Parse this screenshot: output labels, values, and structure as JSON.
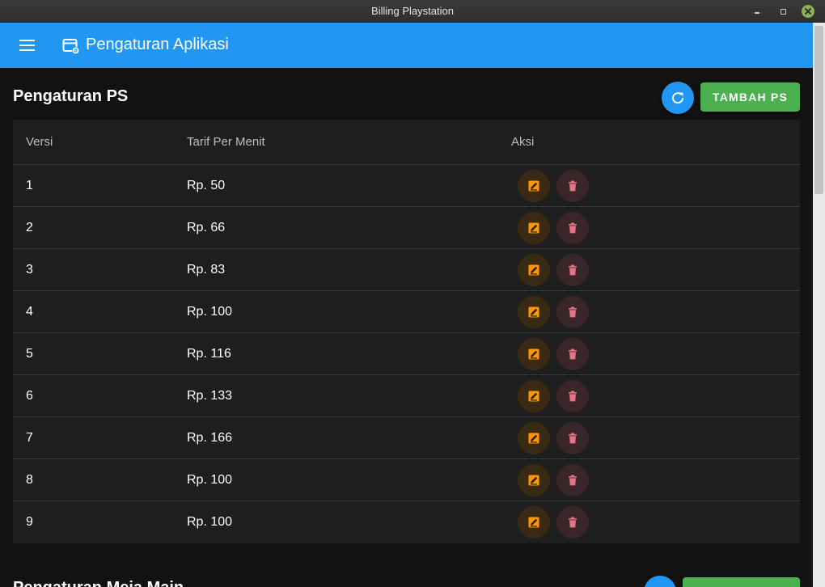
{
  "window": {
    "title": "Billing Playstation"
  },
  "appbar": {
    "title": "Pengaturan Aplikasi"
  },
  "ps_section": {
    "title": "Pengaturan PS",
    "add_label": "TAMBAH PS",
    "columns": [
      "Versi",
      "Tarif Per Menit",
      "Aksi"
    ],
    "rows": [
      {
        "versi": "1",
        "tarif": "Rp. 50"
      },
      {
        "versi": "2",
        "tarif": "Rp. 66"
      },
      {
        "versi": "3",
        "tarif": "Rp. 83"
      },
      {
        "versi": "4",
        "tarif": "Rp. 100"
      },
      {
        "versi": "5",
        "tarif": "Rp. 116"
      },
      {
        "versi": "6",
        "tarif": "Rp. 133"
      },
      {
        "versi": "7",
        "tarif": "Rp. 166"
      },
      {
        "versi": "8",
        "tarif": "Rp. 100"
      },
      {
        "versi": "9",
        "tarif": "Rp. 100"
      }
    ]
  },
  "next_section": {
    "title": "Pengaturan Meja Main"
  },
  "colors": {
    "appbar": "#2196f3",
    "add_button": "#4caf50",
    "edit_icon": "#ff9800",
    "delete_icon": "#e57385",
    "background": "#121212",
    "table": "#1e1e1e"
  },
  "icons": {
    "menu": "menu-icon",
    "app": "app-settings-icon",
    "refresh": "refresh-icon",
    "edit": "edit-icon",
    "delete": "delete-icon"
  }
}
